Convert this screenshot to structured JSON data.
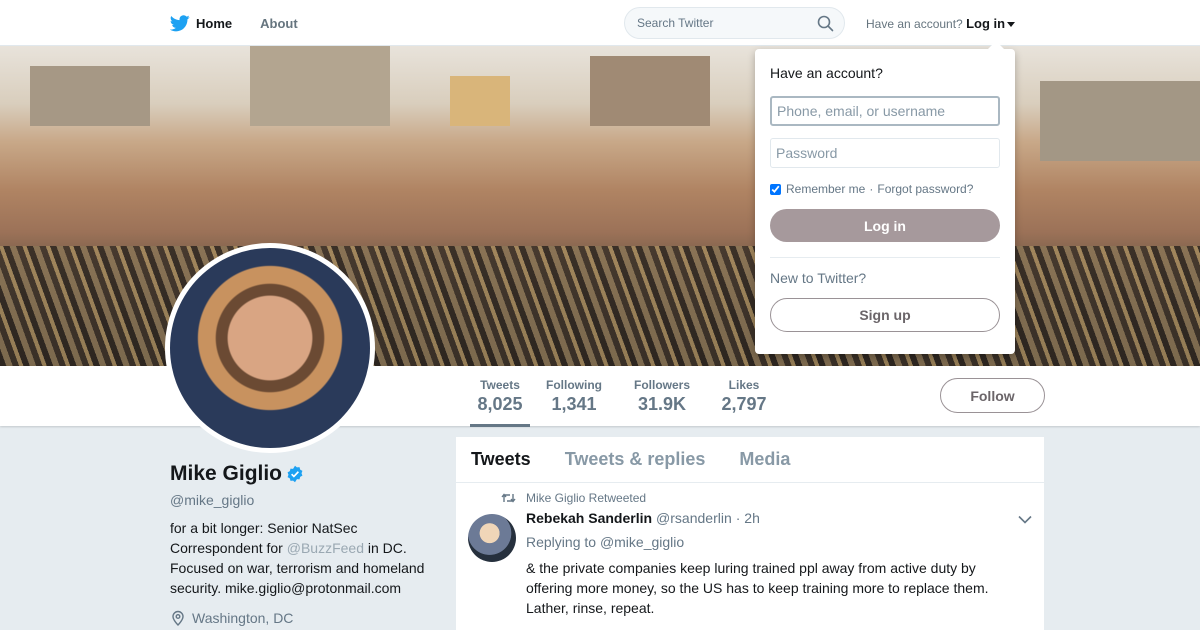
{
  "nav": {
    "home_label": "Home",
    "about_label": "About",
    "search_placeholder": "Search Twitter",
    "account_prompt": "Have an account?",
    "login_label": "Log in"
  },
  "profile": {
    "name": "Mike Giglio",
    "handle": "@mike_giglio",
    "bio_before": "for a bit longer: Senior NatSec Correspondent for ",
    "bio_mention": "@BuzzFeed",
    "bio_after": " in DC. Focused on war, terrorism and homeland security. mike.giglio@protonmail.com",
    "location": "Washington, DC",
    "verified": true
  },
  "stats": [
    {
      "label": "Tweets",
      "value": "8,025"
    },
    {
      "label": "Following",
      "value": "1,341"
    },
    {
      "label": "Followers",
      "value": "31.9K"
    },
    {
      "label": "Likes",
      "value": "2,797"
    }
  ],
  "follow_label": "Follow",
  "timeline": {
    "tabs": [
      "Tweets",
      "Tweets & replies",
      "Media"
    ],
    "tweet": {
      "context": "Mike Giglio Retweeted",
      "name": "Rebekah Sanderlin",
      "handle": "@rsanderlin",
      "time": "· 2h",
      "reply_prefix": "Replying to",
      "reply_to": "@mike_giglio",
      "text": "& the private companies keep luring trained ppl away from active duty by offering more money, so the US has to keep training more to replace them. Lather, rinse, repeat."
    }
  },
  "login_dropdown": {
    "title": "Have an account?",
    "username_placeholder": "Phone, email, or username",
    "password_placeholder": "Password",
    "remember_label": "Remember me",
    "forgot_label": "Forgot password?",
    "login_button": "Log in",
    "new_prompt": "New to Twitter?",
    "signup_button": "Sign up"
  },
  "colors": {
    "twitter_blue": "#1da1f2",
    "verified_blue": "#1da1f2",
    "muted_text": "#657786",
    "button_muted": "#a6999c"
  }
}
